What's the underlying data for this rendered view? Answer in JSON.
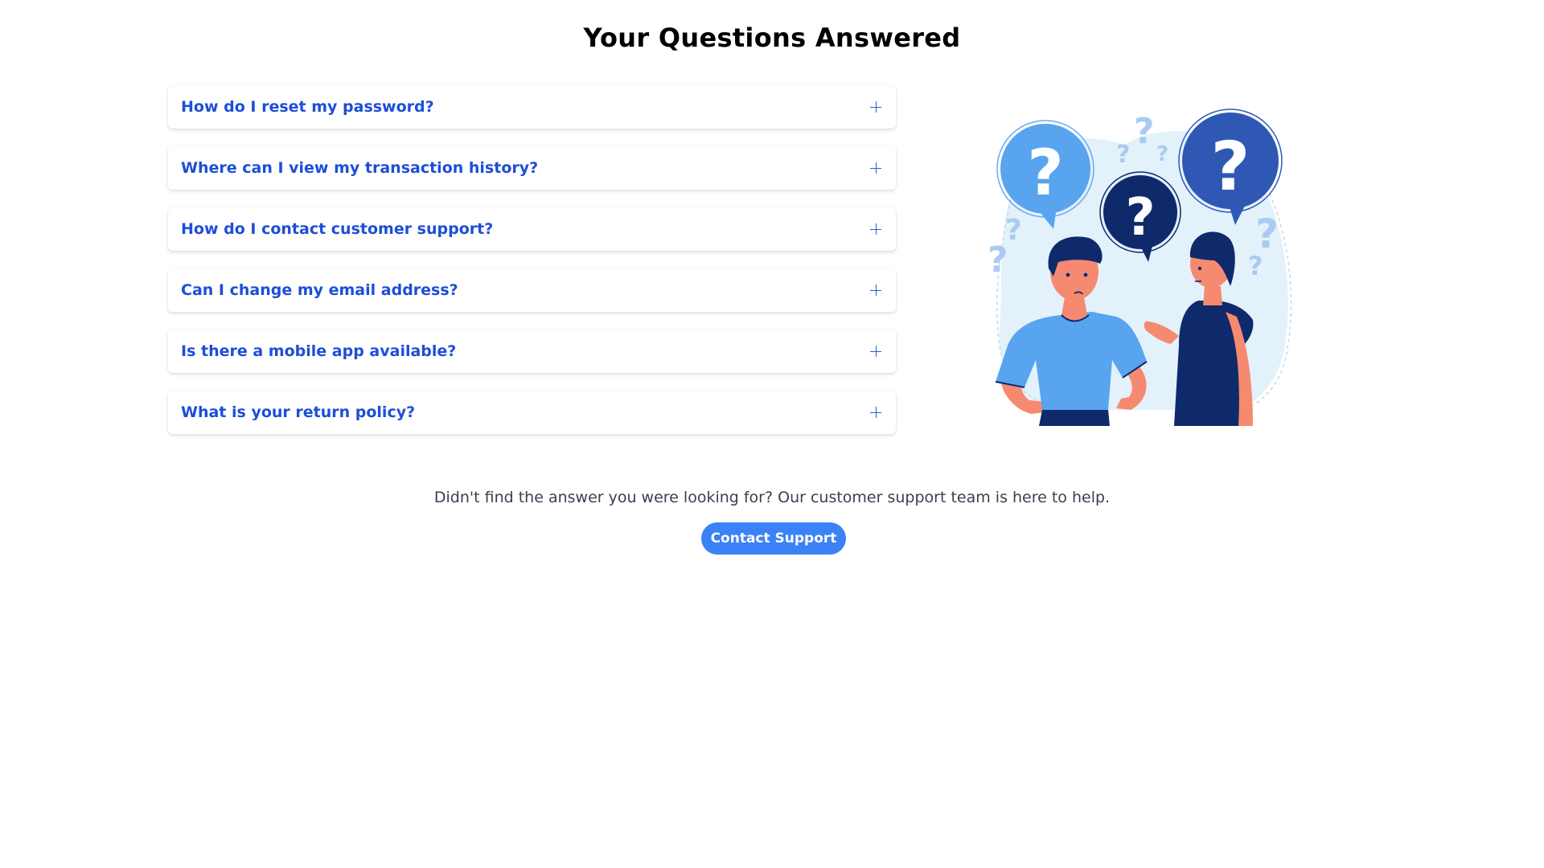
{
  "page": {
    "title": "Your Questions Answered"
  },
  "faq": {
    "items": [
      {
        "question": "How do I reset my password?"
      },
      {
        "question": "Where can I view my transaction history?"
      },
      {
        "question": "How do I contact customer support?"
      },
      {
        "question": "Can I change my email address?"
      },
      {
        "question": "Is there a mobile app available?"
      },
      {
        "question": "What is your return policy?"
      }
    ],
    "toggle_icon": "plus-icon"
  },
  "illustration": {
    "icon": "people-with-question-marks-illustration"
  },
  "support": {
    "help_text": "Didn't find the answer you were looking for? Our customer support team is here to help.",
    "button_label": "Contact Support"
  },
  "colors": {
    "accent": "#3b82f6",
    "question_text": "#1d4ed8",
    "illustration_dark": "#0f2a6b",
    "illustration_mid": "#2f5bb8",
    "illustration_light": "#5aa3f0",
    "skin": "#f58a70"
  }
}
